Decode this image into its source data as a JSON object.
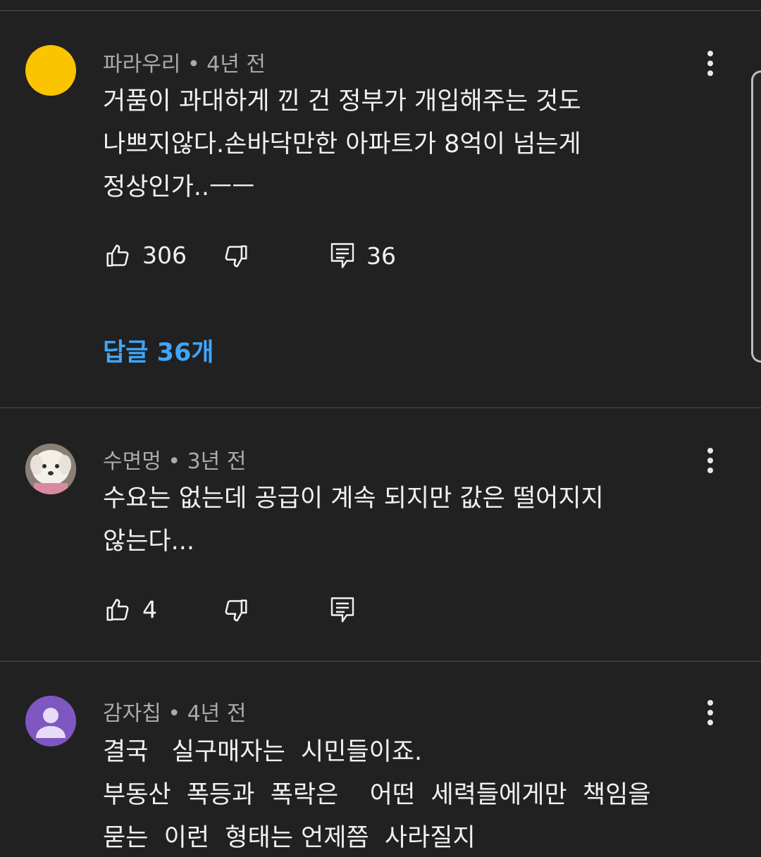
{
  "comments": [
    {
      "author": "파라우리",
      "time": "4년 전",
      "body": "거품이 과대하게 낀 건 정부가 개입해주는 것도\n나쁘지않다.손바닥만한 아파트가 8억이 넘는게\n정상인가..ㅡㅡ",
      "likes": "306",
      "replies_count": "36",
      "replies_label": "답글 36개",
      "avatar_color": "#fbc400"
    },
    {
      "author": "수면멍",
      "time": "3년 전",
      "body": "수요는 없는데 공급이 계속 되지만 값은 떨어지지\n않는다...",
      "likes": "4",
      "avatar_color": "#d9d2c8"
    },
    {
      "author": "감자칩",
      "time": "4년 전",
      "body": "결국   실구매자는  시민들이죠.\n부동산  폭등과  폭락은    어떤  세력들에게만  책임을\n묻는  이런  형태는 언제쯤  사라질지",
      "avatar_color": "#7e57c2"
    }
  ],
  "icons": {
    "like": "thumb-up-icon",
    "dislike": "thumb-down-icon",
    "reply": "comment-icon",
    "menu": "more-vert-icon"
  },
  "colors": {
    "background": "#212121",
    "link": "#3ea6ff",
    "meta": "#aaaaaa",
    "text": "#f1f1f1"
  }
}
